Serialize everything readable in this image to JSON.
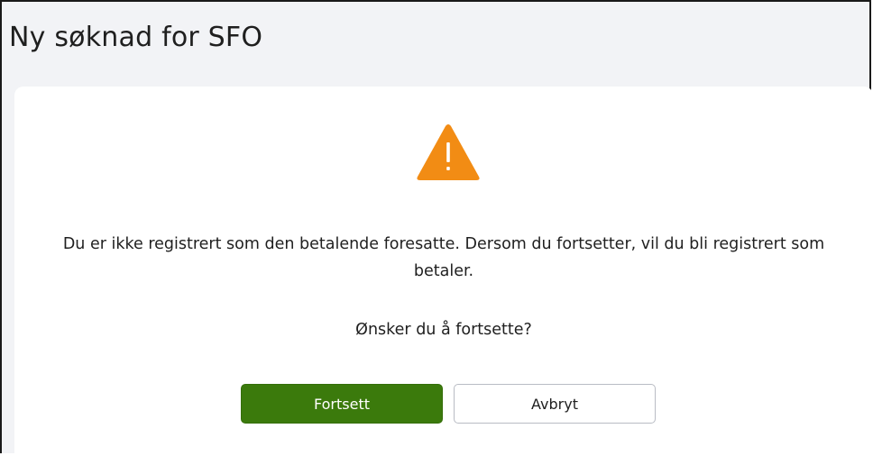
{
  "header": {
    "title": "Ny søknad for SFO"
  },
  "dialog": {
    "icon": "warning-triangle-icon",
    "icon_color": "#f28c14",
    "message": "Du er ikke registrert som den betalende foresatte. Dersom du fortsetter, vil du bli registrert som betaler.",
    "question": "Ønsker du å fortsette?",
    "confirm_label": "Fortsett",
    "cancel_label": "Avbryt"
  },
  "colors": {
    "primary_button": "#3b7a0c",
    "page_background": "#f2f3f6"
  }
}
